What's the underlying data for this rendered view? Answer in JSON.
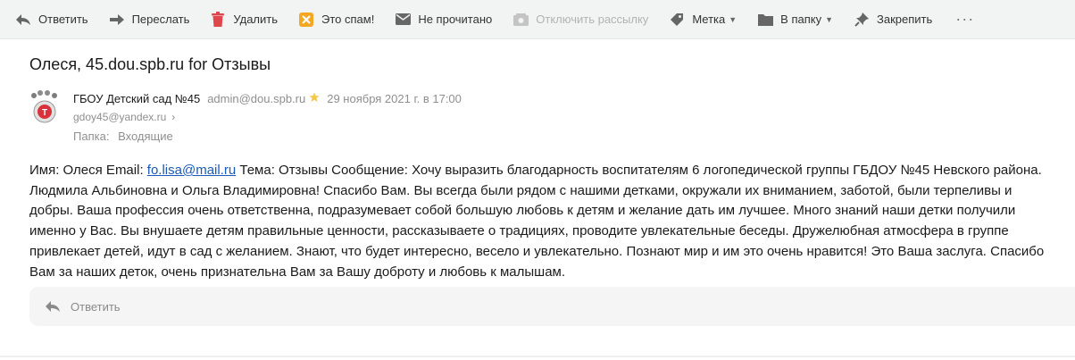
{
  "toolbar": {
    "reply": "Ответить",
    "forward": "Переслать",
    "delete": "Удалить",
    "spam": "Это спам!",
    "unread": "Не прочитано",
    "unsubscribe": "Отключить рассылку",
    "label": "Метка",
    "to_folder": "В папку",
    "pin": "Закрепить",
    "more": "···"
  },
  "message": {
    "subject": "Олеся, 45.dou.spb.ru for Отзывы",
    "sender_name": "ГБОУ Детский сад №45",
    "sender_email": "admin@dou.spb.ru",
    "date": "29 ноября 2021 г. в 17:00",
    "recipient": "gdoy45@yandex.ru",
    "folder_label": "Папка:",
    "folder_name": "Входящие",
    "body_prefix": "Имя: Олеся Email: ",
    "body_link": "fo.lisa@mail.ru",
    "body_rest": " Тема: Отзывы Сообщение: Хочу выразить благодарность воспитателям 6 логопедической группы ГБДОУ №45 Невского района. Людмила Альбиновна и Ольга Владимировна! Спасибо Вам. Вы всегда были рядом с нашими детками, окружали их вниманием, заботой, были терпеливы и добры. Ваша профессия очень ответственна, подразумевает собой большую любовь к детям и желание дать им лучшее. Много знаний наши детки получили именно у Вас. Вы внушаете детям правильные ценности, рассказываете о традициях, проводите увлекательные беседы. Дружелюбная атмосфера в группе привлекает детей, идут в сад с желанием. Знают, что будет интересно, весело и увлекательно. Познают мир и им это очень нравится! Это Ваша заслуга. Спасибо Вам за наших деток, очень признательна Вам за Вашу доброту и любовь к малышам."
  },
  "reply_box": {
    "label": "Ответить"
  },
  "colors": {
    "link": "#1a59b7",
    "spam_icon": "#f5a623",
    "delete_icon": "#e0474c",
    "star": "#f2c94c"
  },
  "icons": [
    "reply-icon",
    "forward-icon",
    "trash-icon",
    "spam-icon",
    "envelope-icon",
    "unsubscribe-icon",
    "tag-icon",
    "folder-icon",
    "pin-icon",
    "more-icon",
    "star-icon",
    "chevron-right-icon"
  ]
}
